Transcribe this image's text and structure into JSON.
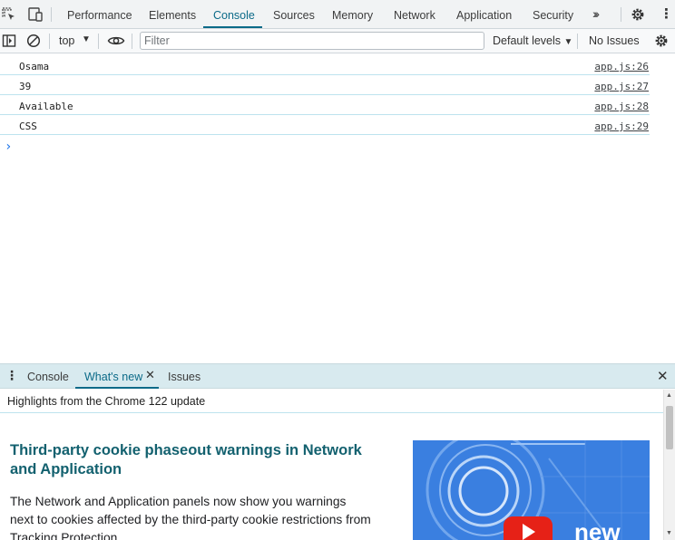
{
  "devtools": {
    "main_tabs": [
      {
        "label": "Performance"
      },
      {
        "label": "Elements"
      },
      {
        "label": "Console"
      },
      {
        "label": "Sources"
      },
      {
        "label": "Memory"
      },
      {
        "label": "Network"
      },
      {
        "label": "Application"
      },
      {
        "label": "Security"
      }
    ],
    "active_tab": "Console",
    "more_tabs_icon": "chevron-double-right-icon",
    "settings_icon": "gear-icon",
    "menu_icon": "vertical-ellipsis-icon"
  },
  "console_toolbar": {
    "sidebar_icon": "sidebar-toggle-icon",
    "clear_icon": "clear-console-icon",
    "context": "top",
    "eye_icon": "eye-icon",
    "filter_placeholder": "Filter",
    "levels": "Default levels",
    "issues": "No Issues",
    "settings_icon": "gear-icon"
  },
  "console": {
    "messages": [
      {
        "text": "Osama",
        "source": "app.js:26"
      },
      {
        "text": "39",
        "source": "app.js:27"
      },
      {
        "text": "Available",
        "source": "app.js:28"
      },
      {
        "text": "CSS",
        "source": "app.js:29"
      }
    ],
    "prompt": "›"
  },
  "drawer": {
    "tabs": [
      {
        "label": "Console"
      },
      {
        "label": "What's new"
      },
      {
        "label": "Issues"
      }
    ],
    "active_tab": "What's new",
    "highlights": "Highlights from the Chrome 122 update",
    "article": {
      "title": "Third-party cookie phaseout warnings in Network and Application",
      "body": "The Network and Application panels now show you warnings next to cookies affected by the third-party cookie restrictions from Tracking Protection.",
      "image_text": "new"
    }
  },
  "colors": {
    "accent": "#0b6a88",
    "drawer_bg": "#d8eaef",
    "row_border": "#bde3ee",
    "title_color": "#13616f",
    "hero_blue": "#3a7fe0",
    "youtube_red": "#e62117"
  }
}
